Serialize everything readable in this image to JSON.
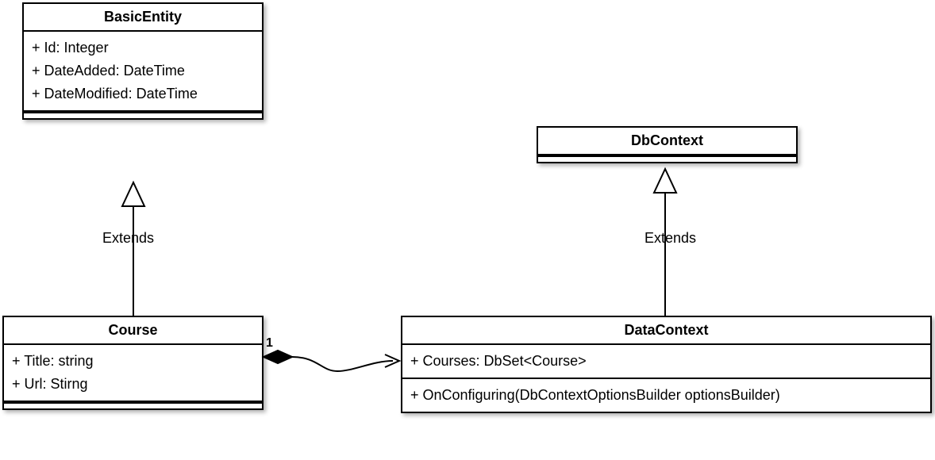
{
  "classes": {
    "basicEntity": {
      "name": "BasicEntity",
      "attributes": [
        "+ Id: Integer",
        "+ DateAdded: DateTime",
        "+ DateModified: DateTime"
      ]
    },
    "course": {
      "name": "Course",
      "attributes": [
        "+ Title: string",
        "+ Url: Stirng"
      ]
    },
    "dbContext": {
      "name": "DbContext"
    },
    "dataContext": {
      "name": "DataContext",
      "attributes": [
        "+ Courses: DbSet<Course>"
      ],
      "operations": [
        "+ OnConfiguring(DbContextOptionsBuilder optionsBuilder)"
      ]
    }
  },
  "relationships": {
    "extends1": {
      "label": "Extends"
    },
    "extends2": {
      "label": "Extends"
    },
    "composition": {
      "multiplicity": "1"
    }
  }
}
